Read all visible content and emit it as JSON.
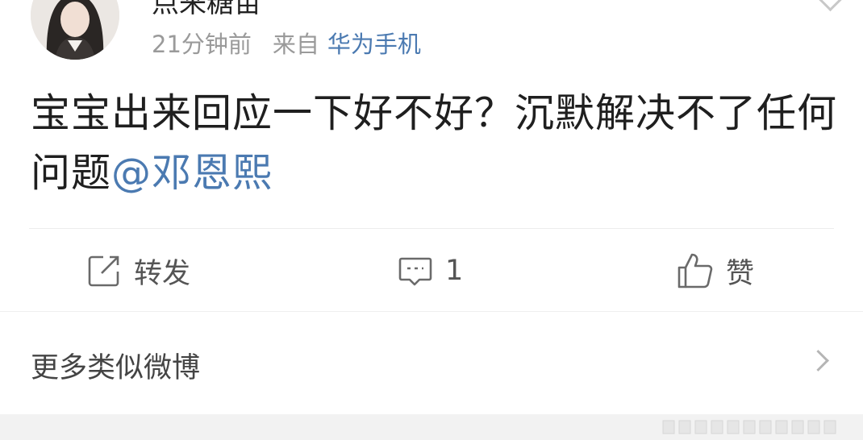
{
  "post": {
    "username": "点来糖苗",
    "time": "21分钟前",
    "from_label": "来自",
    "source": "华为手机",
    "text": "宝宝出来回应一下好不好？沉默解决不了任何问题",
    "mention": "@邓恩熙"
  },
  "actions": {
    "repost": {
      "label": "转发",
      "icon": "share-icon"
    },
    "comment": {
      "count": "1",
      "icon": "comment-icon"
    },
    "like": {
      "label": "赞",
      "icon": "thumbs-up-icon"
    }
  },
  "more": {
    "label": "更多类似微博",
    "icon": "chevron-right-icon"
  },
  "colors": {
    "link": "#4b7ab1",
    "meta": "#9a9a9a",
    "text": "#1f1f1f",
    "divider": "#ececec"
  }
}
